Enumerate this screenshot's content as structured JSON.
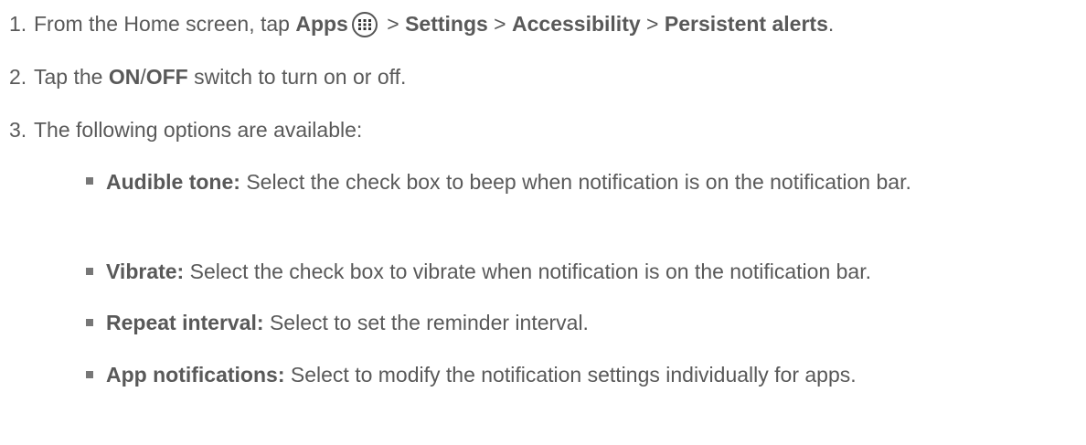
{
  "steps": [
    {
      "num": "1.",
      "prefix": "From the Home screen, tap ",
      "apps_label": "Apps",
      "apps_icon": "apps-grid-icon",
      "sep": " > ",
      "path": [
        "Settings",
        "Accessibility",
        "Persistent alerts"
      ],
      "suffix": "."
    },
    {
      "num": "2.",
      "prefix": "Tap the ",
      "on_label": "ON",
      "slash": "/",
      "off_label": "OFF",
      "suffix": " switch to turn on or off."
    },
    {
      "num": "3.",
      "text": "The following options are available:"
    }
  ],
  "options": [
    {
      "title": "Audible tone:",
      "desc": " Select the check box to beep when notification is on the notification bar."
    },
    {
      "title": "Vibrate:",
      "desc": " Select the check box to vibrate when notification is on the notification bar."
    },
    {
      "title": "Repeat interval:",
      "desc": " Select to set the reminder interval."
    },
    {
      "title": "App notifications:",
      "desc": " Select to modify the notification settings individually for apps."
    }
  ]
}
